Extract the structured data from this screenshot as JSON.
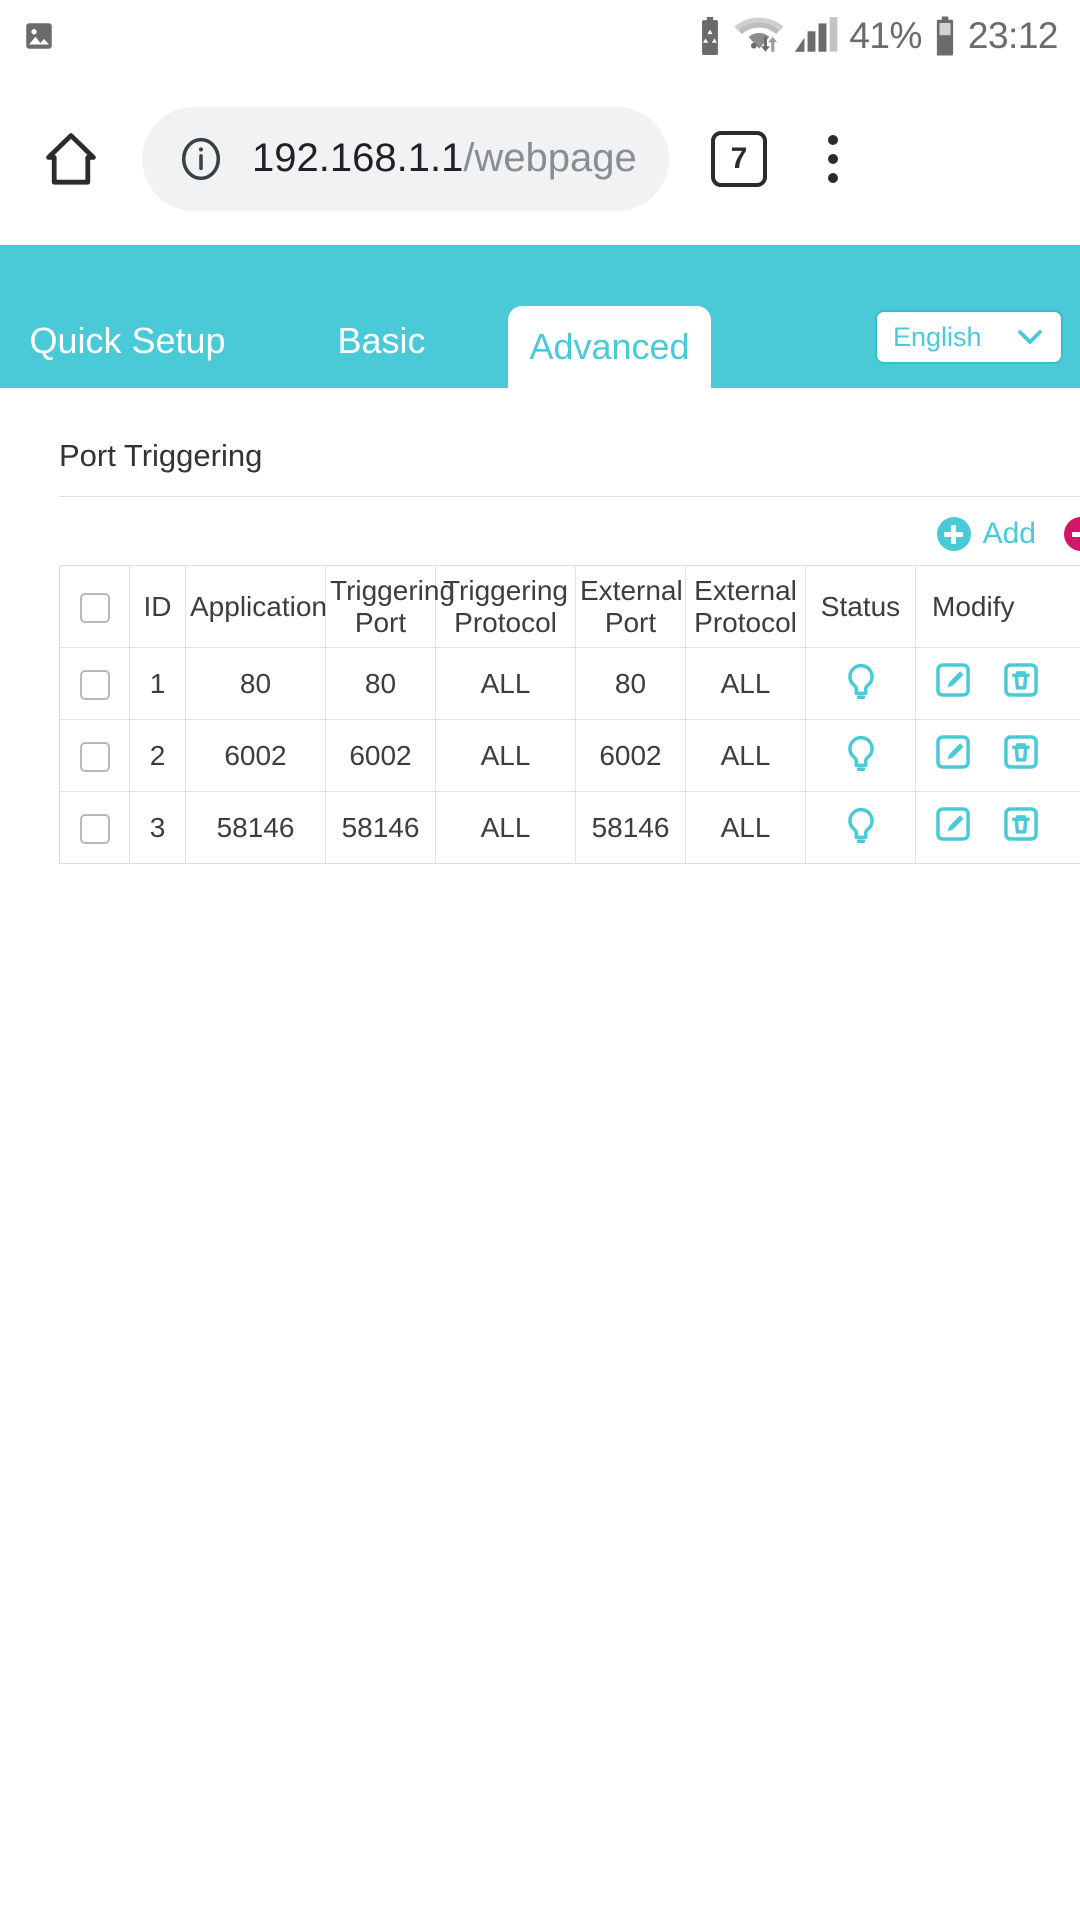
{
  "statusbar": {
    "left_icons": [
      "image-icon"
    ],
    "right_icons": [
      "battery-saver-icon",
      "wifi-icon",
      "signal-icon",
      "battery-icon"
    ],
    "battery_percent": "41%",
    "time": "23:12"
  },
  "browser": {
    "home_icon": "home-icon",
    "info_icon": "info-icon",
    "url_host": "192.168.1.1",
    "url_path": "/webpages",
    "tab_count": "7",
    "menu_icon": "overflow-menu-icon"
  },
  "router": {
    "tabs": [
      {
        "label": "Quick Setup",
        "active": false
      },
      {
        "label": "Basic",
        "active": false
      },
      {
        "label": "Advanced",
        "active": true
      }
    ],
    "language": {
      "selected": "English",
      "options": [
        "English"
      ],
      "chevron_icon": "chevron-down-icon"
    },
    "accent_color": "#4ac9d7",
    "delete_color": "#d4156a"
  },
  "content": {
    "section_title": "Port Triggering",
    "actions": [
      {
        "label": "Add",
        "icon": "plus-circle-icon",
        "color": "#4ac9d7"
      },
      {
        "label": "",
        "icon": "minus-circle-icon",
        "color": "#d4156a"
      }
    ],
    "table": {
      "select_all_checkbox": false,
      "columns": [
        "",
        "ID",
        "Application",
        "Triggering Port",
        "Triggering Protocol",
        "External Port",
        "External Protocol",
        "Status",
        "Modify"
      ],
      "rows": [
        {
          "checked": false,
          "id": "1",
          "application": "80",
          "triggering_port": "80",
          "triggering_protocol": "ALL",
          "external_port": "80",
          "external_protocol": "ALL",
          "status_icon": "lightbulb-icon",
          "modify_icons": [
            "edit-icon",
            "delete-icon"
          ]
        },
        {
          "checked": false,
          "id": "2",
          "application": "6002",
          "triggering_port": "6002",
          "triggering_protocol": "ALL",
          "external_port": "6002",
          "external_protocol": "ALL",
          "status_icon": "lightbulb-icon",
          "modify_icons": [
            "edit-icon",
            "delete-icon"
          ]
        },
        {
          "checked": false,
          "id": "3",
          "application": "58146",
          "triggering_port": "58146",
          "triggering_protocol": "ALL",
          "external_port": "58146",
          "external_protocol": "ALL",
          "status_icon": "lightbulb-icon",
          "modify_icons": [
            "edit-icon",
            "delete-icon"
          ]
        }
      ]
    }
  }
}
